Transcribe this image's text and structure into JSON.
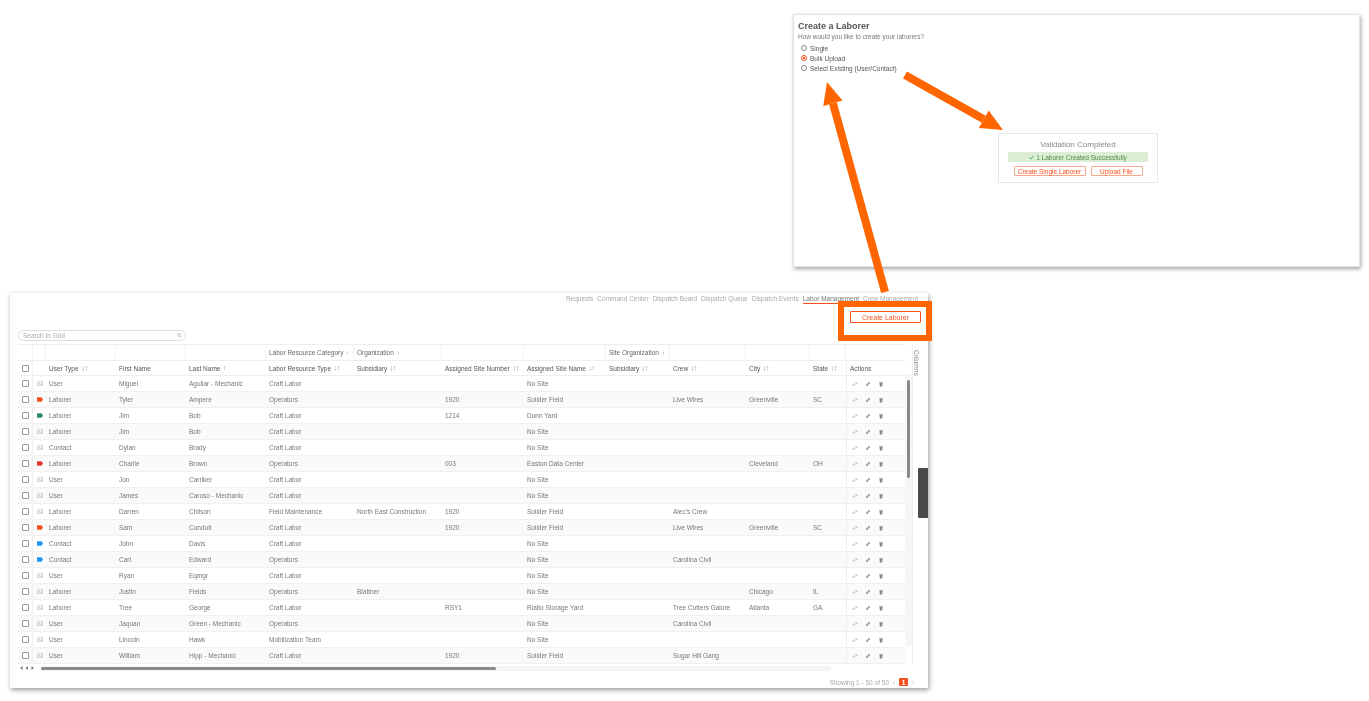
{
  "dialog": {
    "title": "Create a Laborer",
    "prompt": "How would you like to create your laborers?",
    "options": [
      {
        "label": "Single",
        "selected": false
      },
      {
        "label": "Bulk Upload",
        "selected": true
      },
      {
        "label": "Select Existing (User/Contact)",
        "selected": false
      }
    ],
    "validation": {
      "title": "Validation Completed",
      "message": "1 Laborer Created Successfully",
      "buttons": [
        "Create Single Laborer",
        "Upload File"
      ]
    }
  },
  "nav": {
    "tabs": [
      {
        "label": "Requests",
        "selected": false
      },
      {
        "label": "Command Center",
        "selected": false
      },
      {
        "label": "Dispatch Board",
        "selected": false
      },
      {
        "label": "Dispatch Queue",
        "selected": false
      },
      {
        "label": "Dispatch Events",
        "selected": false
      },
      {
        "label": "Labor Management",
        "selected": true
      },
      {
        "label": "Crew Management",
        "selected": false
      }
    ]
  },
  "create_button": {
    "label": "Create Laborer"
  },
  "search": {
    "placeholder": "Search In Grid"
  },
  "table": {
    "select_all_checked": false,
    "columns": [
      {
        "label": "User Type",
        "sortable": true
      },
      {
        "label": "First Name"
      },
      {
        "label": "Last Name",
        "sorted_ascending": true
      },
      {
        "label": "Labor Resource Type",
        "sortable": true,
        "group": "Labor Resource Category"
      },
      {
        "label": "Subsidiary",
        "sortable": true,
        "group": "Organization"
      },
      {
        "label": "Assigned Site Number",
        "sortable": true
      },
      {
        "label": "Assigned Site Name",
        "sortable": true
      },
      {
        "label": "Subsidiary",
        "sortable": true,
        "group": "Site Organization"
      },
      {
        "label": "Crew",
        "sortable": true
      },
      {
        "label": "City",
        "sortable": true
      },
      {
        "label": "State",
        "sortable": true
      },
      {
        "label": "Actions"
      }
    ],
    "rows": [
      {
        "checked": false,
        "user_type": "User",
        "first_name": "Miguel",
        "last_name": "Aguilar - Mechanic",
        "resource_type": "Craft Labor",
        "site_name": "No Site"
      },
      {
        "checked": false,
        "color": "#f4511e",
        "user_type": "Laborer",
        "first_name": "Tyler",
        "last_name": "Ampere",
        "resource_type": "Operators",
        "site_number": "1920",
        "site_name": "Solider Field",
        "crew": "Live Wires",
        "city": "Greenville",
        "state": "SC"
      },
      {
        "checked": false,
        "color": "#2e8b7a",
        "user_type": "Laborer",
        "first_name": "Jim",
        "last_name": "Bob",
        "resource_type": "Craft Labor",
        "site_number": "1214",
        "site_name": "Dunn Yard"
      },
      {
        "checked": false,
        "user_type": "Laborer",
        "first_name": "Jim",
        "last_name": "Bob",
        "resource_type": "Craft Labor",
        "site_name": "No Site"
      },
      {
        "checked": false,
        "user_type": "Contact",
        "first_name": "Dylan",
        "last_name": "Brady",
        "resource_type": "Craft Labor",
        "site_name": "No Site"
      },
      {
        "checked": false,
        "color": "#e53935",
        "user_type": "Laborer",
        "first_name": "Charlie",
        "last_name": "Brown",
        "resource_type": "Operators",
        "site_number": "003",
        "site_name": "Easton Data Center",
        "city": "Cleveland",
        "state": "OH"
      },
      {
        "checked": false,
        "user_type": "User",
        "first_name": "Jon",
        "last_name": "Carriker",
        "resource_type": "Craft Labor",
        "site_name": "No Site"
      },
      {
        "checked": false,
        "user_type": "User",
        "first_name": "James",
        "last_name": "Caruso - Mechanic",
        "resource_type": "Craft Labor",
        "site_name": "No Site"
      },
      {
        "checked": false,
        "user_type": "Laborer",
        "first_name": "Darren",
        "last_name": "Chilson",
        "resource_type": "Field Maintenance",
        "subsidiary": "North East Construction",
        "site_number": "1920",
        "site_name": "Solider Field",
        "crew": "Alec's Crew"
      },
      {
        "checked": false,
        "color": "#f4511e",
        "user_type": "Laborer",
        "first_name": "Sam",
        "last_name": "Conduit",
        "resource_type": "Craft Labor",
        "site_number": "1920",
        "site_name": "Solider Field",
        "crew": "Live Wires",
        "city": "Greenville",
        "state": "SC"
      },
      {
        "checked": false,
        "color": "#2196f3",
        "user_type": "Contact",
        "first_name": "John",
        "last_name": "Davis",
        "resource_type": "Craft Labor",
        "site_name": "No Site"
      },
      {
        "checked": false,
        "color": "#2196f3",
        "user_type": "Contact",
        "first_name": "Carl",
        "last_name": "Edward",
        "resource_type": "Operators",
        "site_name": "No Site",
        "crew": "Carolina Civil"
      },
      {
        "checked": false,
        "user_type": "User",
        "first_name": "Ryan",
        "last_name": "Eqmgr",
        "resource_type": "Craft Labor",
        "site_name": "No Site"
      },
      {
        "checked": false,
        "user_type": "Laborer",
        "first_name": "Justin",
        "last_name": "Fields",
        "resource_type": "Operators",
        "subsidiary": "Blattner",
        "site_name": "No Site",
        "city": "Chicago",
        "state": "IL"
      },
      {
        "checked": false,
        "user_type": "Laborer",
        "first_name": "Tree",
        "last_name": "George",
        "resource_type": "Craft Labor",
        "site_number": "RSY1",
        "site_name": "Rialto Storage Yard",
        "crew": "Tree Cutters Galore",
        "city": "Atlanta",
        "state": "GA"
      },
      {
        "checked": false,
        "user_type": "User",
        "first_name": "Jaquan",
        "last_name": "Green - Mechanic",
        "resource_type": "Operators",
        "site_name": "No Site",
        "crew": "Carolina Civil"
      },
      {
        "checked": false,
        "user_type": "User",
        "first_name": "Lincoln",
        "last_name": "Hawk",
        "resource_type": "Mobilization Team",
        "site_name": "No Site"
      },
      {
        "checked": false,
        "user_type": "User",
        "first_name": "William",
        "last_name": "Hipp - Mechanic",
        "resource_type": "Craft Labor",
        "site_number": "1920",
        "site_name": "Solider Field",
        "crew": "Sugar Hill Gang"
      }
    ]
  },
  "side_panel": {
    "label": "Columns"
  },
  "pagination": {
    "summary": "Showing 1 - 50 of 50",
    "pages": [
      {
        "label": "1",
        "selected": true
      }
    ]
  }
}
